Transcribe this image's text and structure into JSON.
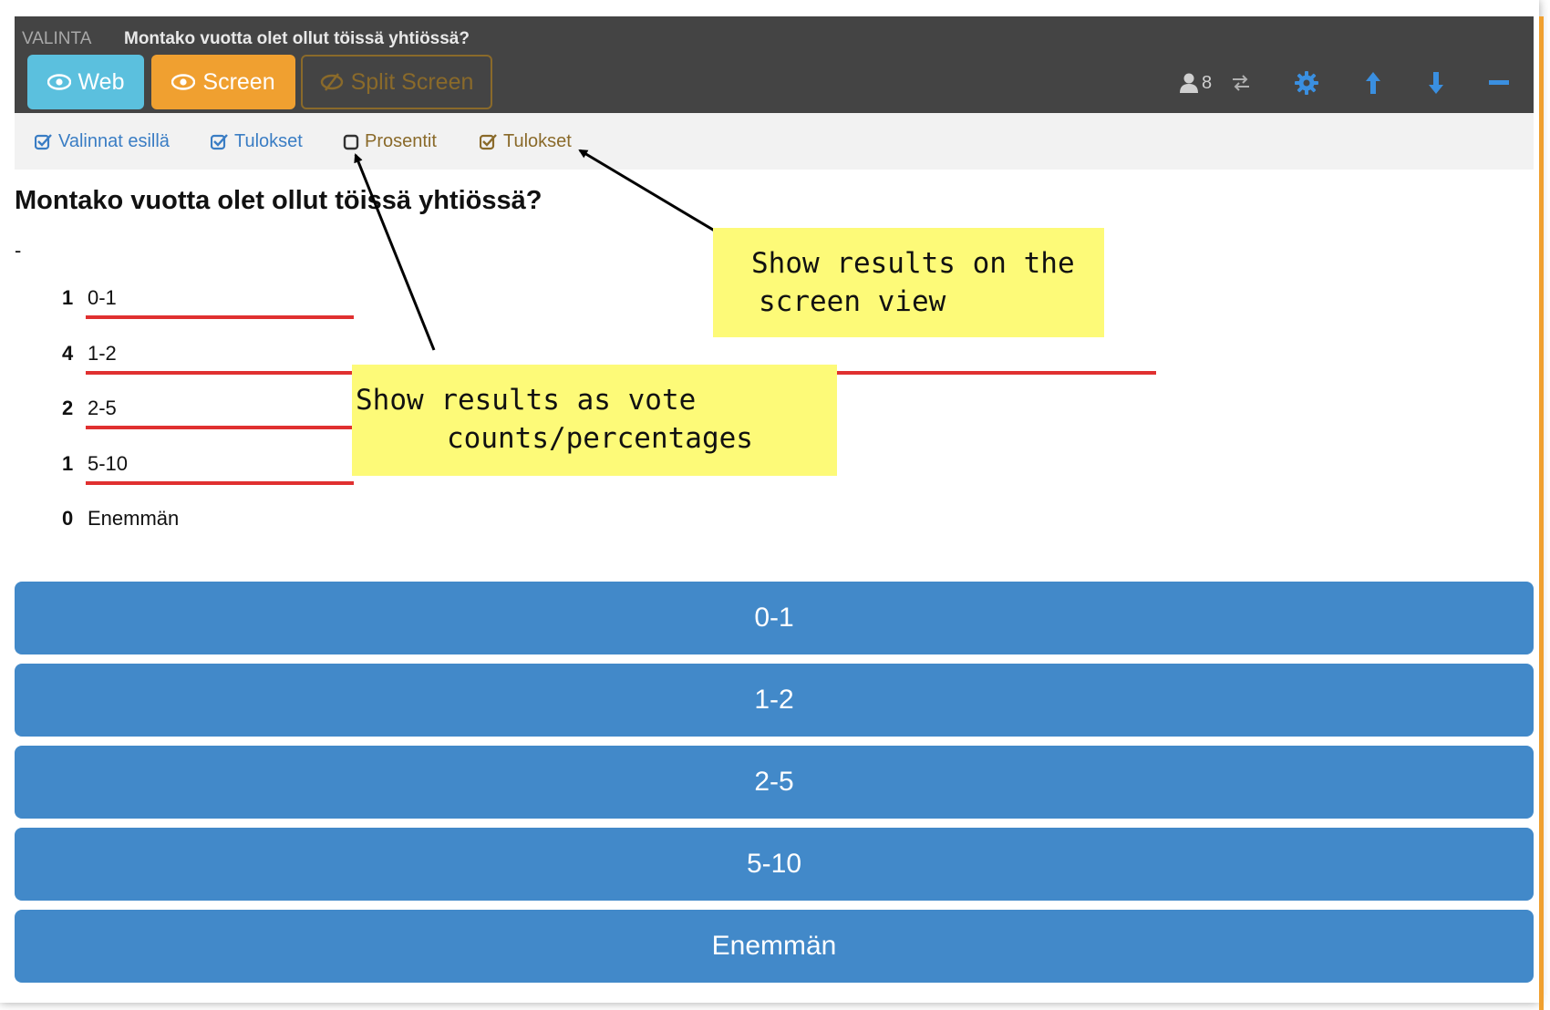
{
  "header": {
    "kind": "VALINTA",
    "title": "Montako vuotta olet ollut töissä yhtiössä?",
    "modes": {
      "web": "Web",
      "screen": "Screen",
      "split": "Split Screen"
    },
    "user_count": "8"
  },
  "options": {
    "valinnat": "Valinnat esillä",
    "tulokset1": "Tulokset",
    "prosentit": "Prosentit",
    "tulokset2": "Tulokset"
  },
  "question": "Montako vuotta olet ollut töissä yhtiössä?",
  "description": "-",
  "results": [
    {
      "count": "1",
      "label": "0-1",
      "fraction": 0.25
    },
    {
      "count": "4",
      "label": "1-2",
      "fraction": 1.0
    },
    {
      "count": "2",
      "label": "2-5",
      "fraction": 0.5
    },
    {
      "count": "1",
      "label": "5-10",
      "fraction": 0.25
    },
    {
      "count": "0",
      "label": "Enemmän",
      "fraction": 0
    }
  ],
  "choices": [
    "0-1",
    "1-2",
    "2-5",
    "5-10",
    "Enemmän"
  ],
  "annotations": {
    "note1_line1": "Show results on the",
    "note1_line2": "screen view",
    "note2_line1": "Show results as vote",
    "note2_line2": "counts/percentages"
  },
  "colors": {
    "header_bg": "#444444",
    "web": "#5bc0de",
    "screen": "#f0a030",
    "choice": "#4289c9",
    "bar": "#e03030",
    "note": "#fdfa78"
  }
}
